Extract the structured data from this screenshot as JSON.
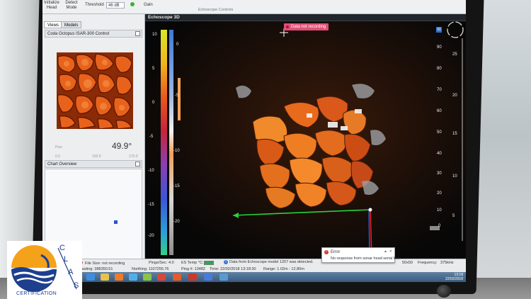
{
  "ribbon": {
    "initialize_head": "Initialize Head",
    "detect_mode": "Detect Mode",
    "threshold_label": "Threshold",
    "threshold_value": "46 dB",
    "gain_label": "Gain",
    "group_label": "Echoscope Controls"
  },
  "left_panel": {
    "tabs": [
      "Views",
      "Models"
    ],
    "card_title": "Coda Octopus ISAR-300 Control",
    "pan_label": "Pan",
    "pan_value": "49.9°",
    "scale_ticks": [
      "0.0",
      "100.0",
      "170.0"
    ],
    "overview_title": "Chart Overview"
  },
  "view3d": {
    "title": "Echoscope 3D",
    "recording_badge": "Data not recording",
    "zero_tag": "00",
    "depth_ticks": [
      "90",
      "80",
      "70",
      "60",
      "50",
      "40",
      "30",
      "20",
      "10",
      "0"
    ],
    "range_ticks": [
      "25",
      "20",
      "15",
      "10",
      "5"
    ],
    "color_scale_ticks": [
      "10",
      "5",
      "0",
      "-5",
      "-10",
      "-15",
      "-20"
    ],
    "color_scale_ticks_secondary": [
      "0",
      "-5",
      "-10",
      "-15",
      "-20"
    ]
  },
  "status": {
    "file_size": "File Size: not recording",
    "pings_per_sec_label": "Pings/Sec:",
    "pings_per_sec": "4.0",
    "es_temp_label": "ES Temp °C:",
    "info_message": "Data from Echoscope model 1207 was detected.",
    "easting": "Easting: 388350.51",
    "northing": "Northing: 1107255.76",
    "ping": "Ping #: 13482",
    "time": "Time: 22/02/2018 13:18:30",
    "range": "Range: 1.02m - 12.80m",
    "resolution": "50x50",
    "frequency_label": "Frequency:",
    "frequency": "375kHz"
  },
  "error": {
    "title": "Error",
    "message": "No response from sonar head serial line"
  },
  "taskbar": {
    "clock_time": "13:18",
    "clock_date": "22/02/2018"
  },
  "logo": {
    "letters": [
      "C",
      "L",
      "A",
      "S"
    ],
    "caption": "CERTIFICATION"
  },
  "colors": {
    "sonar_orange": "#e0641a",
    "status_green": "#2fa84a",
    "recording_pink": "#e05078",
    "axis_green": "#27d13a",
    "axis_red": "#e8232a",
    "axis_blue": "#2b6cff"
  }
}
